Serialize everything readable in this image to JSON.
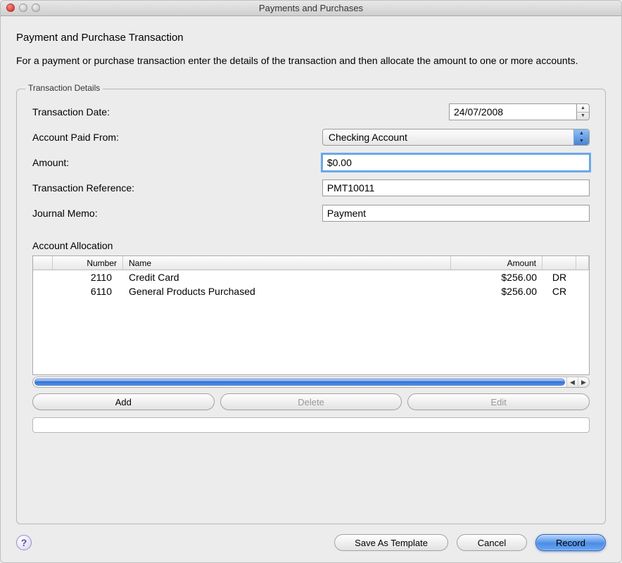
{
  "window_title": "Payments and Purchases",
  "heading": "Payment and Purchase Transaction",
  "description": "For a payment or purchase transaction enter the details of the transaction and then allocate the amount to one or more accounts.",
  "fieldset_legend": "Transaction Details",
  "labels": {
    "date": "Transaction Date:",
    "account_from": "Account Paid From:",
    "amount": "Amount:",
    "reference": "Transaction Reference:",
    "memo": "Journal Memo:"
  },
  "values": {
    "date": "24/07/2008",
    "account_from": "Checking Account",
    "amount": "$0.00",
    "reference": "PMT10011",
    "memo": "Payment"
  },
  "allocation_heading": "Account Allocation",
  "columns": {
    "number": "Number",
    "name": "Name",
    "amount": "Amount"
  },
  "rows": [
    {
      "number": "2110",
      "name": "Credit Card",
      "amount": "$256.00",
      "drcr": "DR"
    },
    {
      "number": "6110",
      "name": "General Products Purchased",
      "amount": "$256.00",
      "drcr": "CR"
    }
  ],
  "buttons": {
    "add": "Add",
    "delete": "Delete",
    "edit": "Edit",
    "save_template": "Save As Template",
    "cancel": "Cancel",
    "record": "Record",
    "help": "?"
  }
}
